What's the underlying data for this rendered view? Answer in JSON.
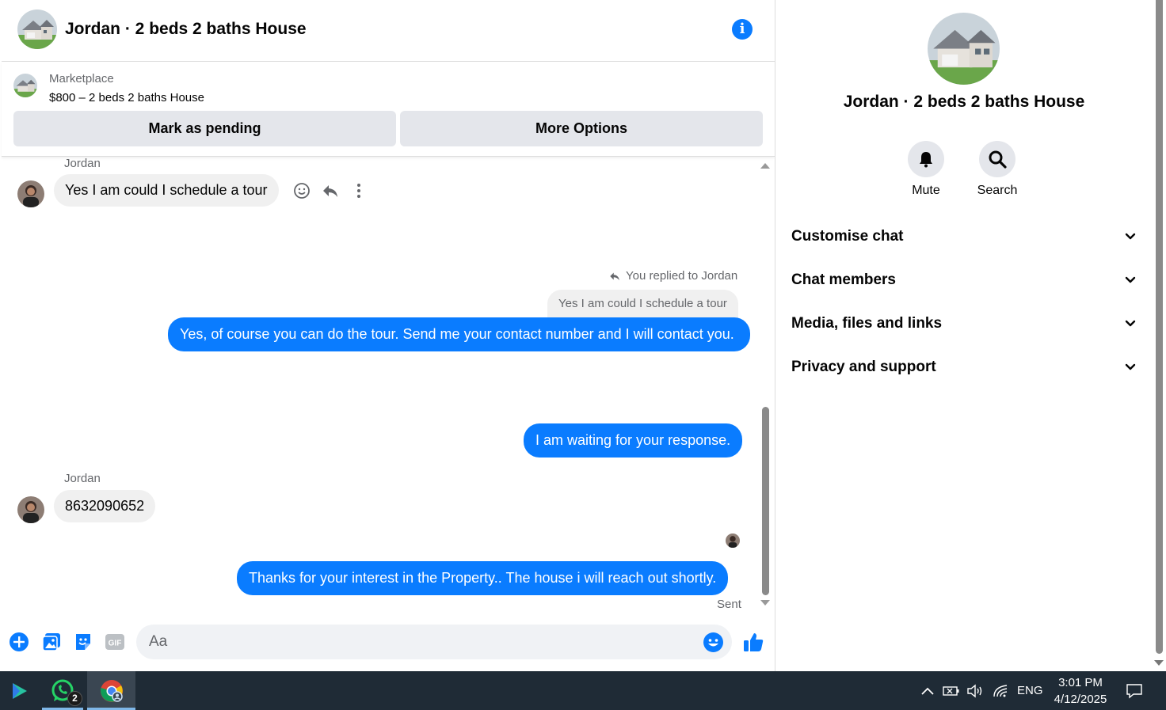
{
  "conversation": {
    "title": "Jordan · 2 beds 2 baths House"
  },
  "listing": {
    "source": "Marketplace",
    "price_title": "$800 – 2 beds 2 baths House",
    "mark_pending_label": "Mark as pending",
    "more_options_label": "More Options"
  },
  "messages": {
    "first": {
      "sender": "Jordan",
      "text": "Yes I am could I schedule a tour"
    },
    "reply": {
      "replied_label": "You replied to Jordan",
      "quoted_text": "Yes I am could I schedule a tour",
      "text": "Yes, of course you can do the tour. Send me your contact number and I will contact you."
    },
    "waiting": {
      "text": "I am waiting for your response."
    },
    "number": {
      "sender": "Jordan",
      "text": "8632090652"
    },
    "thanks": {
      "text": "Thanks for your interest in the Property.. The house i will reach  out shortly.",
      "status": "Sent"
    }
  },
  "composer": {
    "placeholder": "Aa"
  },
  "info_panel": {
    "name": "Jordan · 2 beds 2 baths House",
    "actions": [
      {
        "label": "Mute",
        "icon": "bell-icon"
      },
      {
        "label": "Search",
        "icon": "search-icon"
      }
    ],
    "sections": [
      {
        "label": "Customise chat"
      },
      {
        "label": "Chat members"
      },
      {
        "label": "Media, files and links"
      },
      {
        "label": "Privacy and support"
      }
    ]
  },
  "taskbar": {
    "whatsapp_badge": "2",
    "language": "ENG",
    "time": "3:01 PM",
    "date": "4/12/2025"
  },
  "colors": {
    "accent": "#0a7cff",
    "incoming_bubble": "#f0f0f0",
    "taskbar": "#1f2b36"
  }
}
